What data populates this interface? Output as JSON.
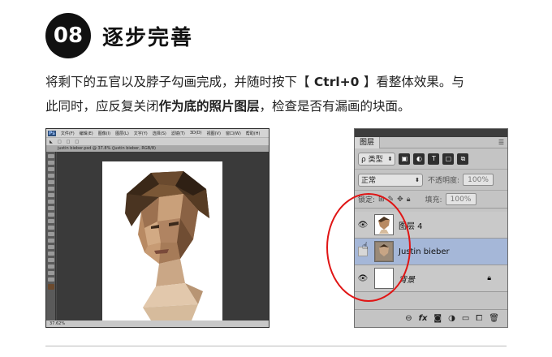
{
  "header": {
    "step_number": "08",
    "title": "逐步完善"
  },
  "paragraph": {
    "line1_a": "将剩下的五官以及脖子勾画完成，并随时按下【",
    "line1_key": " Ctrl+0 ",
    "line1_b": "】看整体效果。与",
    "line2_a": "此同时，应反复关闭",
    "line2_bold": "作为底的照片图层",
    "line2_b": "，检查是否有漏画的块面。"
  },
  "photoshop": {
    "logo": "Ps",
    "menu": [
      "文件(F)",
      "编辑(E)",
      "图像(I)",
      "图层(L)",
      "文字(Y)",
      "选择(S)",
      "滤镜(T)",
      "3D(D)",
      "视图(V)",
      "窗口(W)",
      "帮助(H)"
    ],
    "doc_tab": "justin bieber.psd @ 37.8% (Justin bieber, RGB/8)",
    "zoom_status": "37.62%"
  },
  "layers_panel": {
    "tab_label": "图层",
    "filter_label": "ρ 类型",
    "blend_mode": "正常",
    "opacity_label": "不透明度:",
    "opacity_value": "100%",
    "lock_label": "锁定:",
    "fill_label": "填充:",
    "fill_value": "100%",
    "layers": [
      {
        "name": "图层 4",
        "visible": true,
        "selected": false
      },
      {
        "name": "Justin bieber",
        "visible": false,
        "selected": true
      },
      {
        "name": "背景",
        "visible": true,
        "selected": false,
        "locked": true
      }
    ]
  },
  "colors": {
    "highlight": "#e01515",
    "selected_layer": "#a5b7d8"
  }
}
